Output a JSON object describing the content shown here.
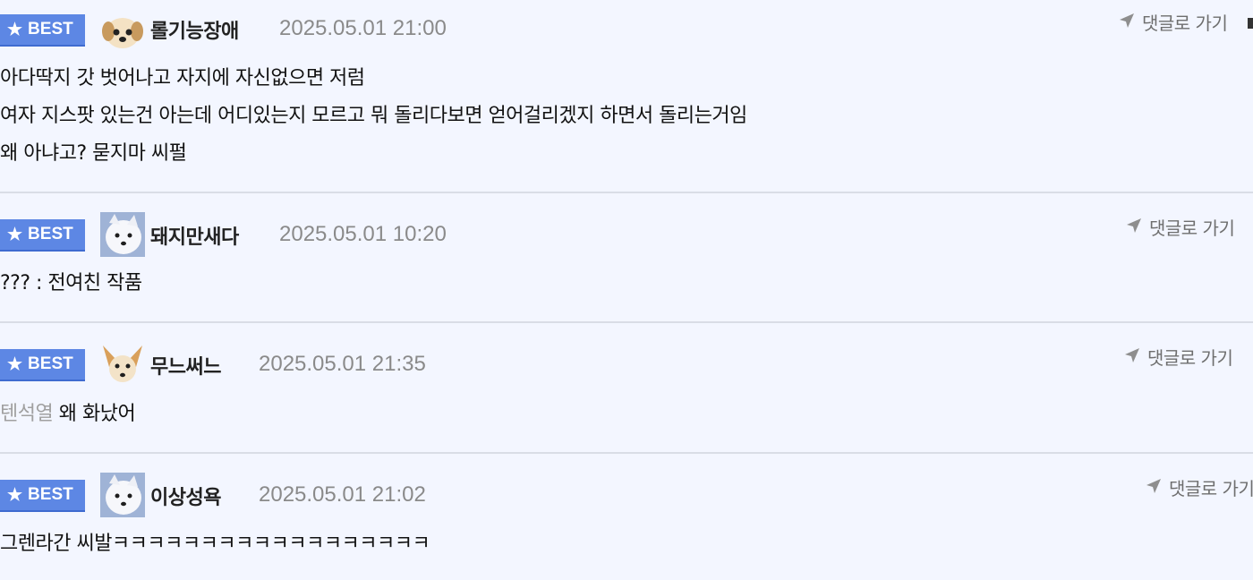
{
  "comments": [
    {
      "badge": "BEST",
      "nickname": "롤기능장애",
      "date": "2025.05.01 21:00",
      "goto_label": "댓글로 가기",
      "avatar": "puppy-face-avatar",
      "lines": [
        "아다딱지 갓 벗어나고 자지에 자신없으면 저럼",
        "여자 지스팟 있는건 아는데 어디있는지 모르고 뭐 돌리다보면 얻어걸리겠지 하면서 돌리는거임",
        "왜 아냐고? 묻지마 씨펄"
      ]
    },
    {
      "badge": "BEST",
      "nickname": "돼지만새다",
      "date": "2025.05.01 10:20",
      "goto_label": "댓글로 가기",
      "avatar": "white-dog-avatar",
      "lines": [
        "??? : 전여친 작품"
      ]
    },
    {
      "badge": "BEST",
      "nickname": "무느써느",
      "date": "2025.05.01 21:35",
      "goto_label": "댓글로 가기",
      "avatar": "chihuahua-avatar",
      "mention": "텐석열",
      "text": "왜 화났어"
    },
    {
      "badge": "BEST",
      "nickname": "이상성욕",
      "date": "2025.05.01 21:02",
      "goto_label": "댓글로 가기",
      "avatar": "white-dog-avatar",
      "lines": [
        "그렌라간 씨발ㅋㅋㅋㅋㅋㅋㅋㅋㅋㅋㅋㅋㅋㅋㅋㅋㅋㅋ"
      ]
    }
  ],
  "colors": {
    "background": "#f3f6ff",
    "best_badge": "#5d87e4",
    "divider": "#d9dde6",
    "date_text": "#8a8a8a",
    "mention_text": "#a0a0a0"
  },
  "icons": {
    "badge_icon": "star-icon",
    "goto_icon": "send-arrow-icon"
  }
}
